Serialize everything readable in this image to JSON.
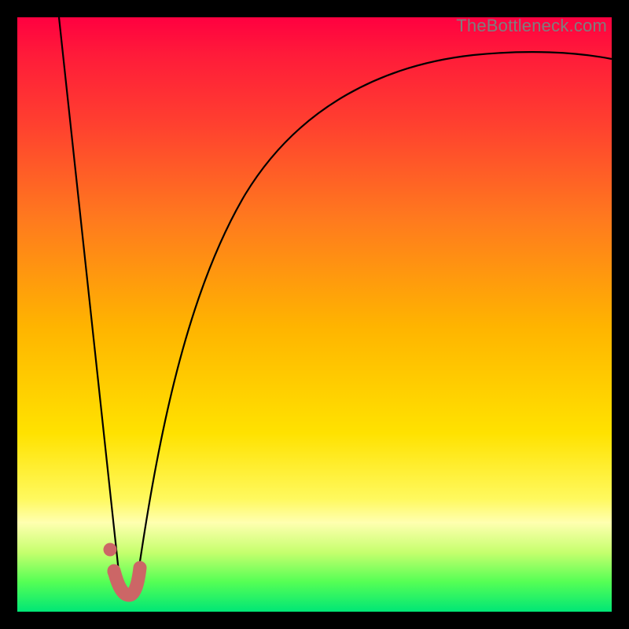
{
  "watermark": "TheBottleneck.com",
  "chart_data": {
    "type": "line",
    "title": "",
    "xlabel": "",
    "ylabel": "",
    "xlim": [
      0,
      100
    ],
    "ylim": [
      0,
      100
    ],
    "grid": false,
    "legend": false,
    "series": [
      {
        "name": "left-slope",
        "color": "#000000",
        "x": [
          7,
          17.5
        ],
        "values": [
          100,
          3
        ]
      },
      {
        "name": "right-curve",
        "color": "#000000",
        "x": [
          20,
          23,
          27,
          32,
          38,
          46,
          56,
          70,
          85,
          100
        ],
        "values": [
          4,
          20,
          38,
          54,
          66,
          76,
          83,
          88,
          91,
          93
        ]
      },
      {
        "name": "markers",
        "color": "#cc6666",
        "x": [
          15.6,
          16.3,
          17.3,
          18.4,
          19.4,
          20.0,
          20.6
        ],
        "values": [
          10.5,
          6.8,
          3.7,
          2.8,
          3.0,
          4.6,
          7.4
        ]
      }
    ],
    "annotations": []
  },
  "colors": {
    "background": "#000000",
    "curve": "#000000",
    "marker_stroke": "#cc6666",
    "marker_fill": "#cc6666"
  }
}
